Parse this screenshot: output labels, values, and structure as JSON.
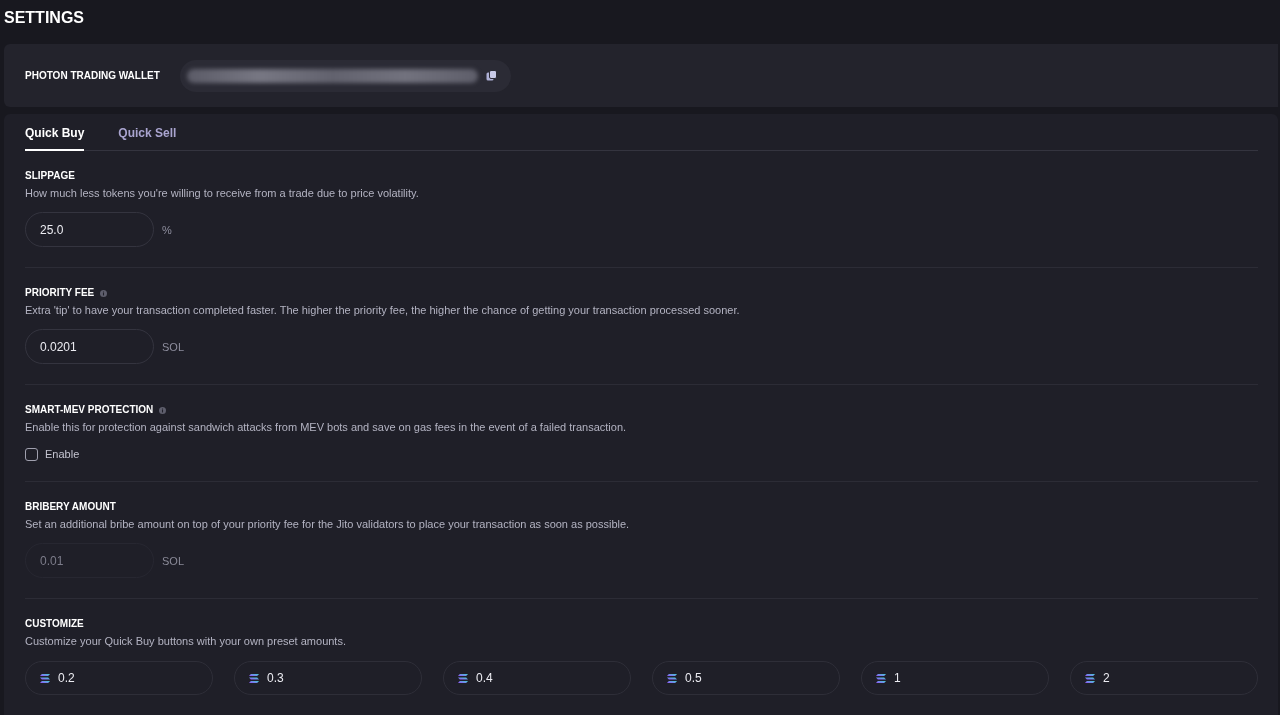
{
  "title": "SETTINGS",
  "wallet": {
    "label": "PHOTON TRADING WALLET"
  },
  "tabs": [
    {
      "label": "Quick Buy",
      "selected": true
    },
    {
      "label": "Quick Sell",
      "selected": false
    }
  ],
  "sections": [
    {
      "kind": "input",
      "heading": "SLIPPAGE",
      "info": false,
      "description": "How much less tokens you're willing to receive from a trade due to price volatility.",
      "value": "25.0",
      "unit": "%",
      "disabled": false
    },
    {
      "kind": "input",
      "heading": "PRIORITY FEE",
      "info": true,
      "description": "Extra 'tip' to have your transaction completed faster. The higher the priority fee, the higher the chance of getting your transaction processed sooner.",
      "value": "0.0201",
      "unit": "SOL",
      "disabled": false
    },
    {
      "kind": "checkbox",
      "heading": "SMART-MEV PROTECTION",
      "info": true,
      "description": "Enable this for protection against sandwich attacks from MEV bots and save on gas fees in the event of a failed transaction.",
      "option": {
        "label": "Enable",
        "checked": false
      }
    },
    {
      "kind": "input",
      "heading": "BRIBERY AMOUNT",
      "info": false,
      "description": "Set an additional bribe amount on top of your priority fee for the Jito validators to place your transaction as soon as possible.",
      "value": "0.01",
      "unit": "SOL",
      "disabled": true
    },
    {
      "kind": "presets",
      "heading": "CUSTOMIZE",
      "info": false,
      "description": "Customize your Quick Buy buttons with your own preset amounts.",
      "presets": [
        "0.2",
        "0.3",
        "0.4",
        "0.5",
        "1",
        "2"
      ]
    }
  ]
}
